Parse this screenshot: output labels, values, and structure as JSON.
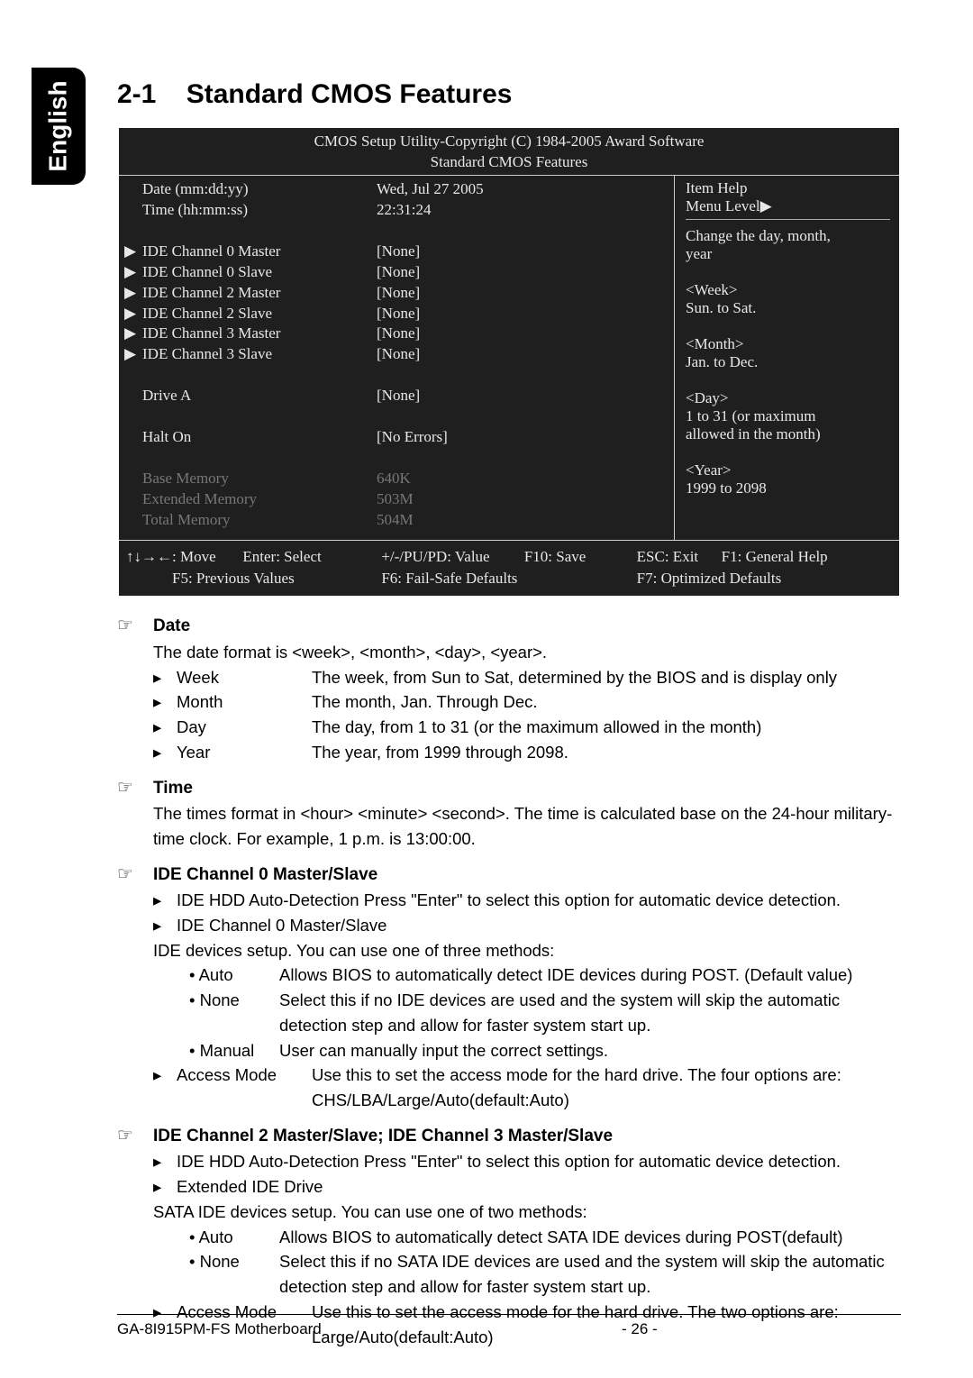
{
  "tab_label": "English",
  "section_number": "2-1",
  "section_title": "Standard CMOS Features",
  "bios": {
    "header_line1": "CMOS Setup Utility-Copyright (C) 1984-2005 Award Software",
    "header_line2": "Standard CMOS Features",
    "rows": [
      {
        "c1": "",
        "c2": "Date (mm:dd:yy)",
        "c3": "Wed, Jul  27  2005"
      },
      {
        "c1": "",
        "c2": "Time (hh:mm:ss)",
        "c3": "22:31:24"
      },
      {
        "spacer": true
      },
      {
        "c1": "▶",
        "c2": "IDE Channel 0 Master",
        "c3": "[None]"
      },
      {
        "c1": "▶",
        "c2": "IDE Channel 0 Slave",
        "c3": "[None]"
      },
      {
        "c1": "▶",
        "c2": "IDE Channel 2 Master",
        "c3": "[None]"
      },
      {
        "c1": "▶",
        "c2": "IDE Channel 2 Slave",
        "c3": "[None]"
      },
      {
        "c1": "▶",
        "c2": "IDE Channel 3 Master",
        "c3": "[None]"
      },
      {
        "c1": "▶",
        "c2": "IDE Channel 3 Slave",
        "c3": "[None]"
      },
      {
        "spacer": true
      },
      {
        "c1": "",
        "c2": "Drive A",
        "c3": "[None]"
      },
      {
        "spacer": true
      },
      {
        "c1": "",
        "c2": "Halt On",
        "c3": "[No Errors]"
      },
      {
        "spacer": true
      },
      {
        "c1": "",
        "c2": "Base Memory",
        "c3": "640K",
        "dim": true
      },
      {
        "c1": "",
        "c2": "Extended Memory",
        "c3": "503M",
        "dim": true
      },
      {
        "c1": "",
        "c2": "Total Memory",
        "c3": "504M",
        "dim": true
      }
    ],
    "help": {
      "title": "Item Help",
      "menu_level": "Menu Level▶",
      "lines": [
        "Change the day, month,",
        "year",
        "",
        "<Week>",
        "Sun. to Sat.",
        "",
        "<Month>",
        "Jan. to Dec.",
        "",
        "<Day>",
        "1 to 31 (or maximum",
        "allowed in the month)",
        "",
        "<Year>",
        "1999 to 2098"
      ]
    },
    "footer": {
      "col1a": "↑↓→←: Move",
      "col1b": "Enter: Select",
      "col2a": "+/-/PU/PD: Value",
      "col2b": "F10: Save",
      "col3a": "ESC: Exit",
      "col3b": "F1: General Help",
      "row2a": "F5: Previous Values",
      "row2b": "F6: Fail-Safe Defaults",
      "row2c": "F7: Optimized Defaults"
    }
  },
  "doc": {
    "date": {
      "title": "Date",
      "intro": "The date format is <week>, <month>, <day>, <year>.",
      "items": [
        {
          "k": "Week",
          "v": "The week, from Sun to Sat, determined by the BIOS and is display only"
        },
        {
          "k": "Month",
          "v": "The month, Jan. Through Dec."
        },
        {
          "k": "Day",
          "v": "The day, from 1 to 31 (or the maximum allowed in the month)"
        },
        {
          "k": "Year",
          "v": "The year, from 1999 through 2098."
        }
      ]
    },
    "time": {
      "title": "Time",
      "text": "The times format in <hour> <minute> <second>. The time is calculated base on the 24-hour military-time clock. For example, 1 p.m. is 13:00:00."
    },
    "ide0": {
      "title": "IDE Channel 0 Master/Slave",
      "l1": "IDE HDD Auto-Detection Press \"Enter\" to select this option for automatic device detection.",
      "l2": "IDE Channel 0 Master/Slave",
      "l3": "IDE devices setup.  You can use one of three methods:",
      "opts": [
        {
          "k": "• Auto",
          "v": "Allows BIOS to automatically detect IDE devices during POST. (Default value)"
        },
        {
          "k": "• None",
          "v": "Select this if no IDE devices are used and the system will skip the automatic detection step and allow for faster system start up."
        },
        {
          "k": "• Manual",
          "v": "User can manually input the correct settings."
        }
      ],
      "access_k": "Access Mode",
      "access_v": "Use this to set the access mode for the hard drive. The four options are: CHS/LBA/Large/Auto(default:Auto)"
    },
    "ide23": {
      "title": "IDE Channel 2 Master/Slave; IDE Channel 3 Master/Slave",
      "l1": "IDE HDD Auto-Detection Press \"Enter\" to select this option for automatic device detection.",
      "l2": "Extended IDE Drive",
      "l3": "SATA IDE devices setup. You can use one of two methods:",
      "opts": [
        {
          "k": "• Auto",
          "v": "Allows BIOS to automatically detect SATA IDE devices during POST(default)"
        },
        {
          "k": "• None",
          "v": "Select this if no SATA IDE devices are used and the system will skip the automatic detection step and allow for faster system start up."
        }
      ],
      "access_k": "Access Mode",
      "access_v": "Use this to set the access mode for the hard drive. The two options are: Large/Auto(default:Auto)"
    }
  },
  "footer": {
    "left": "GA-8I915PM-FS Motherboard",
    "right": "- 26 -"
  }
}
